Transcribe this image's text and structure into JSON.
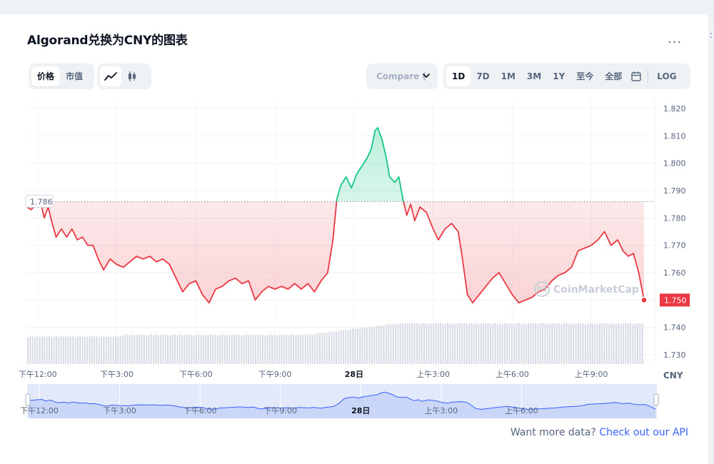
{
  "title": "Algorand兑换为CNY的图表",
  "more_label": "...",
  "view_toggle": {
    "items": [
      {
        "label": "价格",
        "active": true
      },
      {
        "label": "市值",
        "active": false
      }
    ]
  },
  "chart_style": {
    "items": [
      {
        "icon": "line-chart-icon",
        "active": true
      },
      {
        "icon": "candlestick-icon",
        "active": false
      }
    ]
  },
  "compare": {
    "label": "Compare ("
  },
  "ranges": [
    {
      "label": "1D",
      "active": true
    },
    {
      "label": "7D",
      "active": false
    },
    {
      "label": "1M",
      "active": false
    },
    {
      "label": "3M",
      "active": false
    },
    {
      "label": "1Y",
      "active": false
    },
    {
      "label": "至今",
      "active": false
    },
    {
      "label": "全部",
      "active": false
    }
  ],
  "log_label": "LOG",
  "watermark": "CoinMarketCap",
  "footer": {
    "text": "Want more data?",
    "link": "Check out our API"
  },
  "colors": {
    "up": "#16c784",
    "down": "#ea3943",
    "navigator": "#3861fb"
  },
  "chart_data": {
    "type": "line",
    "currency_label": "CNY",
    "ylim": [
      1.726,
      1.822
    ],
    "y_ticks": [
      "1.820",
      "1.810",
      "1.800",
      "1.790",
      "1.780",
      "1.770",
      "1.760",
      "1.750",
      "1.740",
      "1.730"
    ],
    "x_tick_labels": [
      "下午12:00",
      "下午3:00",
      "下午6:00",
      "下午9:00",
      "28日",
      "上午3:00",
      "上午6:00",
      "上午9:00"
    ],
    "x_tick_hours": [
      12,
      15,
      18,
      21,
      24,
      27,
      30,
      33
    ],
    "x_range_hours": [
      11.6,
      35.0
    ],
    "reference_price": 1.786,
    "reference_label": "1.786",
    "last_price": 1.75,
    "last_label": "1.750",
    "grid": true,
    "prices": [
      [
        11.6,
        1.784
      ],
      [
        11.75,
        1.783
      ],
      [
        11.95,
        1.785
      ],
      [
        12.1,
        1.786
      ],
      [
        12.25,
        1.78
      ],
      [
        12.4,
        1.784
      ],
      [
        12.55,
        1.778
      ],
      [
        12.7,
        1.773
      ],
      [
        12.9,
        1.776
      ],
      [
        13.1,
        1.773
      ],
      [
        13.3,
        1.776
      ],
      [
        13.5,
        1.772
      ],
      [
        13.7,
        1.773
      ],
      [
        13.9,
        1.77
      ],
      [
        14.1,
        1.77
      ],
      [
        14.3,
        1.765
      ],
      [
        14.5,
        1.761
      ],
      [
        14.75,
        1.765
      ],
      [
        15.0,
        1.763
      ],
      [
        15.25,
        1.762
      ],
      [
        15.5,
        1.764
      ],
      [
        15.75,
        1.766
      ],
      [
        16.0,
        1.765
      ],
      [
        16.25,
        1.766
      ],
      [
        16.5,
        1.764
      ],
      [
        16.75,
        1.765
      ],
      [
        17.0,
        1.763
      ],
      [
        17.25,
        1.758
      ],
      [
        17.5,
        1.753
      ],
      [
        17.75,
        1.756
      ],
      [
        18.0,
        1.757
      ],
      [
        18.25,
        1.752
      ],
      [
        18.5,
        1.749
      ],
      [
        18.75,
        1.754
      ],
      [
        19.0,
        1.755
      ],
      [
        19.25,
        1.757
      ],
      [
        19.5,
        1.758
      ],
      [
        19.75,
        1.756
      ],
      [
        20.0,
        1.757
      ],
      [
        20.25,
        1.75
      ],
      [
        20.5,
        1.753
      ],
      [
        20.75,
        1.755
      ],
      [
        21.0,
        1.754
      ],
      [
        21.25,
        1.755
      ],
      [
        21.5,
        1.754
      ],
      [
        21.75,
        1.756
      ],
      [
        22.0,
        1.754
      ],
      [
        22.25,
        1.756
      ],
      [
        22.5,
        1.753
      ],
      [
        22.75,
        1.757
      ],
      [
        23.0,
        1.76
      ],
      [
        23.2,
        1.772
      ],
      [
        23.35,
        1.787
      ],
      [
        23.5,
        1.792
      ],
      [
        23.7,
        1.795
      ],
      [
        23.9,
        1.791
      ],
      [
        24.1,
        1.796
      ],
      [
        24.3,
        1.799
      ],
      [
        24.5,
        1.802
      ],
      [
        24.65,
        1.805
      ],
      [
        24.8,
        1.812
      ],
      [
        24.9,
        1.813
      ],
      [
        25.05,
        1.809
      ],
      [
        25.2,
        1.803
      ],
      [
        25.35,
        1.795
      ],
      [
        25.55,
        1.793
      ],
      [
        25.7,
        1.795
      ],
      [
        25.85,
        1.787
      ],
      [
        26.0,
        1.781
      ],
      [
        26.15,
        1.785
      ],
      [
        26.3,
        1.779
      ],
      [
        26.5,
        1.784
      ],
      [
        26.75,
        1.782
      ],
      [
        27.0,
        1.776
      ],
      [
        27.2,
        1.772
      ],
      [
        27.45,
        1.776
      ],
      [
        27.7,
        1.778
      ],
      [
        27.95,
        1.775
      ],
      [
        28.1,
        1.766
      ],
      [
        28.3,
        1.752
      ],
      [
        28.5,
        1.749
      ],
      [
        28.75,
        1.752
      ],
      [
        29.0,
        1.755
      ],
      [
        29.25,
        1.758
      ],
      [
        29.5,
        1.76
      ],
      [
        29.75,
        1.756
      ],
      [
        30.0,
        1.752
      ],
      [
        30.25,
        1.749
      ],
      [
        30.5,
        1.75
      ],
      [
        30.75,
        1.751
      ],
      [
        31.0,
        1.753
      ],
      [
        31.25,
        1.754
      ],
      [
        31.5,
        1.757
      ],
      [
        31.75,
        1.759
      ],
      [
        32.0,
        1.76
      ],
      [
        32.25,
        1.762
      ],
      [
        32.5,
        1.768
      ],
      [
        32.75,
        1.769
      ],
      [
        33.0,
        1.77
      ],
      [
        33.25,
        1.772
      ],
      [
        33.5,
        1.775
      ],
      [
        33.75,
        1.77
      ],
      [
        34.0,
        1.772
      ],
      [
        34.2,
        1.768
      ],
      [
        34.4,
        1.766
      ],
      [
        34.6,
        1.767
      ],
      [
        34.8,
        1.76
      ],
      [
        35.0,
        1.75
      ]
    ]
  }
}
